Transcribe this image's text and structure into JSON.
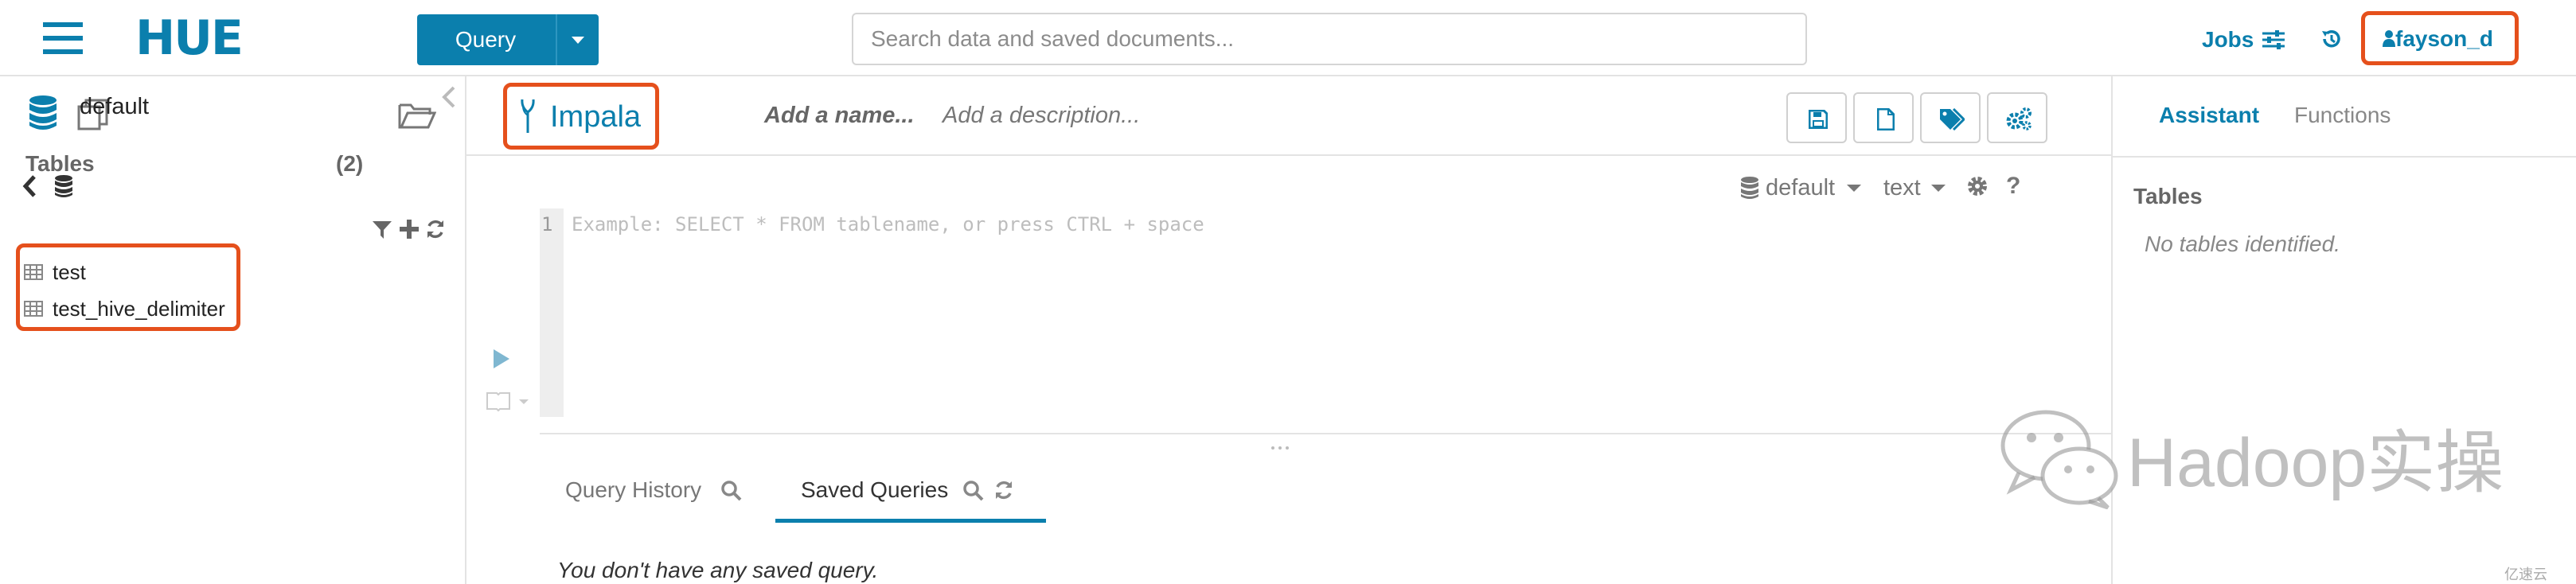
{
  "navbar": {
    "logo_text": "HUE",
    "query_button_label": "Query",
    "search_placeholder": "Search data and saved documents...",
    "jobs_label": "Jobs",
    "user_label": "fayson_d"
  },
  "left_panel": {
    "database_label": "default",
    "tables_heading": "Tables",
    "tables_count": "(2)",
    "tables": [
      "test",
      "test_hive_delimiter"
    ]
  },
  "editor": {
    "interpreter": "Impala",
    "name_placeholder": "Add a name...",
    "description_placeholder": "Add a description...",
    "database_select": "default",
    "format_select": "text",
    "line_number": "1",
    "code_placeholder": "Example: SELECT * FROM tablename, or press CTRL + space"
  },
  "bottom_tabs": {
    "query_history_label": "Query History",
    "saved_queries_label": "Saved Queries",
    "empty_message": "You don't have any saved query."
  },
  "right_panel": {
    "assistant_tab": "Assistant",
    "functions_tab": "Functions",
    "tables_heading": "Tables",
    "no_tables_message": "No tables identified."
  },
  "watermark": {
    "text": "Hadoop实操",
    "corner_text": "亿速云"
  },
  "colors": {
    "brand": "#0b7fad",
    "highlight": "#e5501c"
  }
}
